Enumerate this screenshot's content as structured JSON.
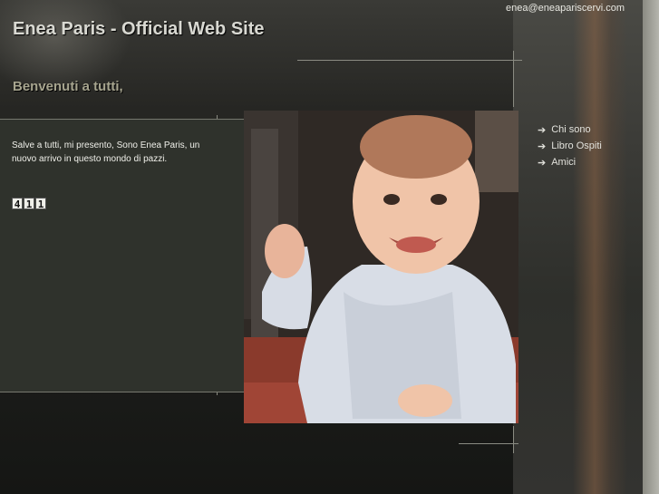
{
  "header": {
    "email": "enea@eneapariscervi.com",
    "title": "Enea Paris - Official Web Site"
  },
  "welcome": "Benvenuti a tutti,",
  "intro": "Salve a tutti, mi presento, Sono Enea Paris, un nuovo arrivo in questo mondo di pazzi.",
  "counter": {
    "digits": [
      "4",
      "1",
      "1"
    ]
  },
  "nav": {
    "items": [
      {
        "label": "Chi sono",
        "icon": "arrow-right-icon"
      },
      {
        "label": "Libro Ospiti",
        "icon": "arrow-right-icon"
      },
      {
        "label": "Amici",
        "icon": "arrow-right-icon"
      }
    ]
  },
  "colors": {
    "title": "#d9d9d2",
    "welcome": "#a7a58f",
    "panel": "#2f322c"
  }
}
